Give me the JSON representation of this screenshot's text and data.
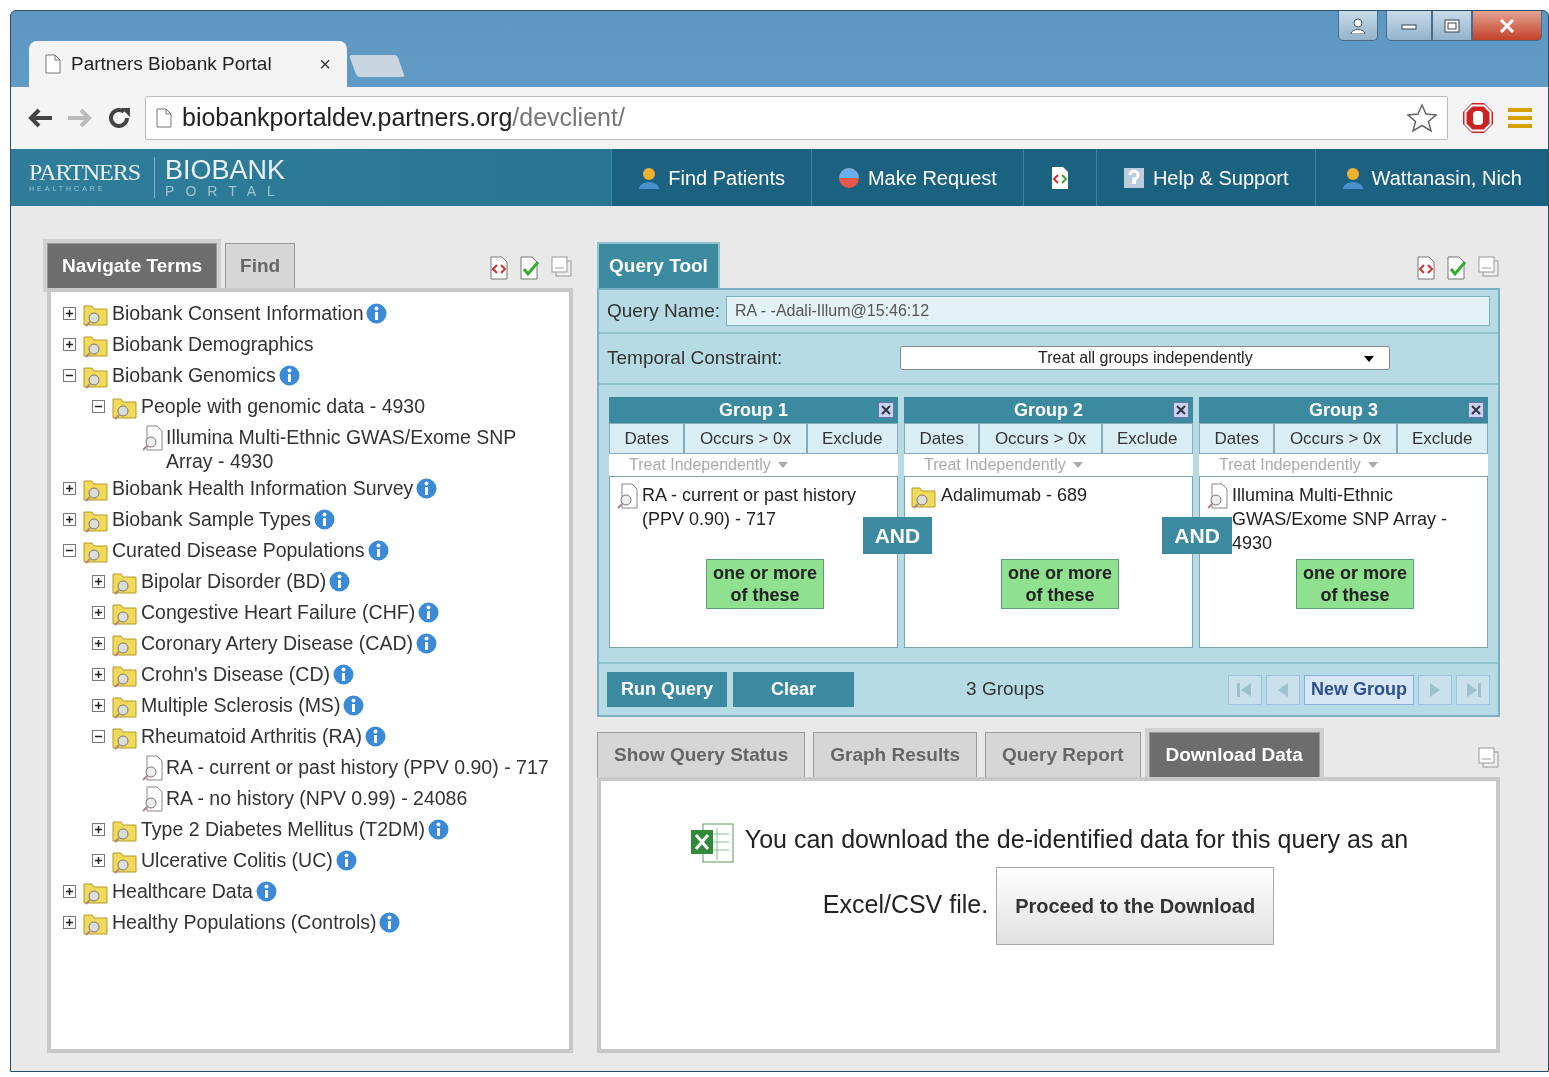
{
  "browser": {
    "tab_title": "Partners Biobank Portal",
    "tab_close": "×",
    "url_host": "biobankportaldev.partners.org",
    "url_path": "/devclient/"
  },
  "header": {
    "logo_main": "PARTNERS",
    "logo_sub": "HEALTHCARE",
    "product": "BIOBANK",
    "product_sub": "PORTAL",
    "nav": [
      {
        "kind": "find",
        "label": "Find Patients"
      },
      {
        "kind": "request",
        "label": "Make Request"
      },
      {
        "kind": "export"
      },
      {
        "kind": "help",
        "label": "Help & Support"
      },
      {
        "kind": "user",
        "label": "Wattanasin, Nich"
      }
    ]
  },
  "left_panel": {
    "tabs": [
      {
        "label": "Navigate Terms",
        "selected": true
      },
      {
        "label": "Find",
        "selected": false
      }
    ],
    "tree": [
      {
        "kind": "folder",
        "label": "Biobank Consent Information",
        "info": true,
        "expanded": false
      },
      {
        "kind": "folder",
        "label": "Biobank Demographics",
        "info": false,
        "expanded": false
      },
      {
        "kind": "folder",
        "label": "Biobank Genomics",
        "info": true,
        "expanded": true,
        "children": [
          {
            "kind": "folder",
            "label": "People with genomic data - 4930",
            "info": false,
            "expanded": true,
            "children": [
              {
                "kind": "leaf",
                "label": "Illumina Multi-Ethnic GWAS/Exome SNP Array - 4930",
                "info": false
              }
            ]
          }
        ]
      },
      {
        "kind": "folder",
        "label": "Biobank Health Information Survey",
        "info": true,
        "expanded": false
      },
      {
        "kind": "folder",
        "label": "Biobank Sample Types",
        "info": true,
        "expanded": false
      },
      {
        "kind": "folder",
        "label": "Curated Disease Populations",
        "info": true,
        "expanded": true,
        "children": [
          {
            "kind": "folder",
            "label": "Bipolar Disorder (BD)",
            "info": true,
            "expanded": false
          },
          {
            "kind": "folder",
            "label": "Congestive Heart Failure (CHF)",
            "info": true,
            "expanded": false
          },
          {
            "kind": "folder",
            "label": "Coronary Artery Disease (CAD)",
            "info": true,
            "expanded": false
          },
          {
            "kind": "folder",
            "label": "Crohn's Disease (CD)",
            "info": true,
            "expanded": false
          },
          {
            "kind": "folder",
            "label": "Multiple Sclerosis (MS)",
            "info": true,
            "expanded": false
          },
          {
            "kind": "folder",
            "label": "Rheumatoid Arthritis (RA)",
            "info": true,
            "expanded": true,
            "children": [
              {
                "kind": "leaf",
                "label": "RA - current or past history (PPV 0.90) - 717",
                "info": false
              },
              {
                "kind": "leaf",
                "label": "RA - no history (NPV 0.99) - 24086",
                "info": false
              }
            ]
          },
          {
            "kind": "folder",
            "label": "Type 2 Diabetes Mellitus (T2DM)",
            "info": true,
            "expanded": false
          },
          {
            "kind": "folder",
            "label": "Ulcerative Colitis (UC)",
            "info": true,
            "expanded": false
          }
        ]
      },
      {
        "kind": "folder",
        "label": "Healthcare Data",
        "info": true,
        "expanded": false
      },
      {
        "kind": "folder",
        "label": "Healthy Populations (Controls)",
        "info": true,
        "expanded": false
      }
    ]
  },
  "query_tool": {
    "tab": "Query Tool",
    "query_name_label": "Query Name:",
    "query_name": "RA - -Adali-Illum@15:46:12",
    "temporal_label": "Temporal Constraint:",
    "temporal_value": "Treat all groups independently",
    "groups": [
      {
        "title": "Group 1",
        "columns": [
          "Dates",
          "Occurs > 0x",
          "Exclude"
        ],
        "treat": "Treat Independently",
        "treat_disabled": true,
        "item": {
          "kind": "leaf",
          "label": "RA - current or past history (PPV 0.90) - 717"
        },
        "operator": "one or more of these"
      },
      {
        "title": "Group 2",
        "columns": [
          "Dates",
          "Occurs > 0x",
          "Exclude"
        ],
        "treat": "Treat Independently",
        "treat_disabled": true,
        "item": {
          "kind": "folder",
          "label": "Adalimumab - 689"
        },
        "operator": "one or more of these"
      },
      {
        "title": "Group 3",
        "columns": [
          "Dates",
          "Occurs > 0x",
          "Exclude"
        ],
        "treat": "Treat Independently",
        "treat_disabled": true,
        "item": {
          "kind": "leaf",
          "label": "Illumina Multi-Ethnic GWAS/Exome SNP Array - 4930"
        },
        "operator": "one or more of these"
      }
    ],
    "connectors": [
      "AND",
      "AND"
    ],
    "run_button": "Run Query",
    "clear_button": "Clear",
    "group_count": "3 Groups",
    "pager": [
      {
        "kind": "first",
        "disabled": true
      },
      {
        "kind": "prev",
        "disabled": true
      },
      {
        "kind": "new",
        "label": "New Group",
        "disabled": false
      },
      {
        "kind": "next",
        "disabled": true
      },
      {
        "kind": "last",
        "disabled": true
      }
    ]
  },
  "results": {
    "tabs": [
      {
        "label": "Show Query Status",
        "selected": false
      },
      {
        "label": "Graph Results",
        "selected": false
      },
      {
        "label": "Query Report",
        "selected": false
      },
      {
        "label": "Download Data",
        "selected": true
      }
    ],
    "message_lines": [
      "You can download the de-identified data for this query as an",
      "Excel/CSV file."
    ],
    "download_button": "Proceed to the Download"
  }
}
